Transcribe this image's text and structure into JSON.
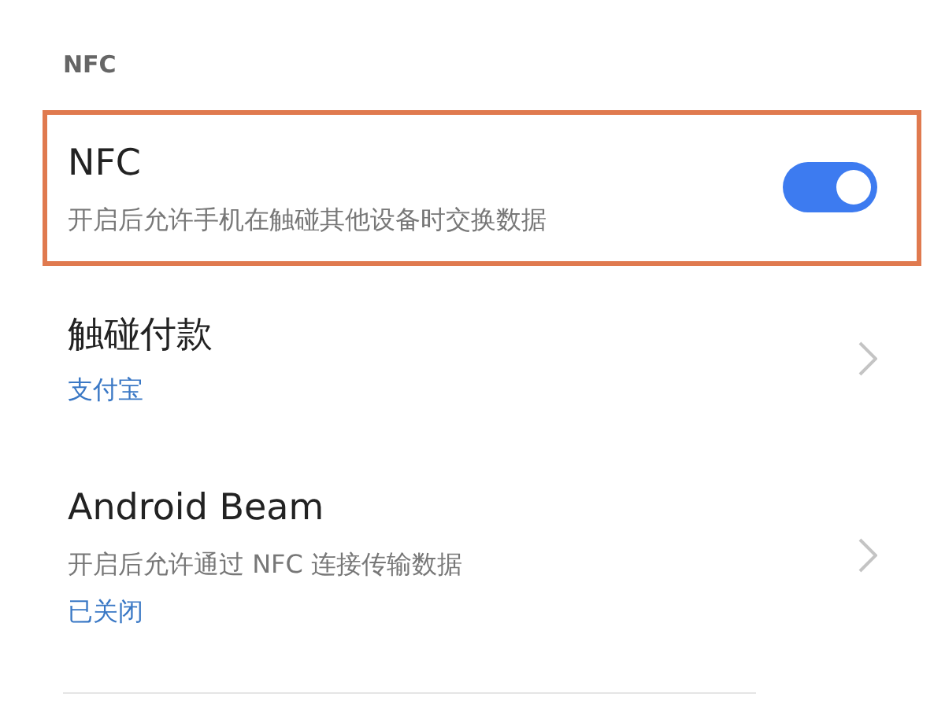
{
  "section_header": "NFC",
  "items": [
    {
      "kind": "toggle",
      "title": "NFC",
      "subtitle": "开启后允许手机在触碰其他设备时交换数据",
      "on": true,
      "highlighted": true
    },
    {
      "kind": "link",
      "title": "触碰付款",
      "value": "支付宝",
      "highlighted": false
    },
    {
      "kind": "link",
      "title": "Android Beam",
      "subtitle": "开启后允许通过 NFC 连接传输数据",
      "value": "已关闭",
      "highlighted": false
    }
  ]
}
